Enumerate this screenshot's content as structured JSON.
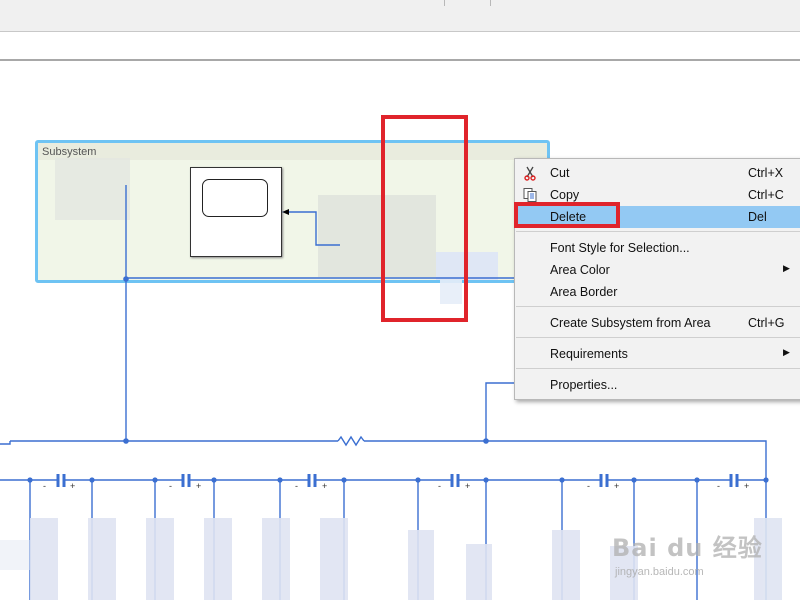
{
  "area": {
    "title": "Subsystem"
  },
  "context_menu": {
    "items": [
      {
        "label": "Cut",
        "shortcut": "Ctrl+X",
        "icon": "scissors-icon"
      },
      {
        "label": "Copy",
        "shortcut": "Ctrl+C",
        "icon": "copy-icon"
      },
      {
        "label": "Delete",
        "shortcut": "Del",
        "highlighted": true
      },
      {
        "label": "Font Style for Selection..."
      },
      {
        "label": "Area Color",
        "submenu": true
      },
      {
        "label": "Area Border"
      },
      {
        "label": "Create Subsystem from Area",
        "shortcut": "Ctrl+G"
      },
      {
        "label": "Requirements",
        "submenu": true
      },
      {
        "label": "Properties..."
      }
    ]
  },
  "component_signs": {
    "minus": "-",
    "plus": "+"
  },
  "watermark": {
    "logo": "Bai du 经验",
    "url": "jingyan.baidu.com"
  },
  "colors": {
    "wire": "#3b6fd1",
    "area_border": "#6ec3f3",
    "highlight": "#93c9f3",
    "annotation_red": "#e0242b"
  }
}
